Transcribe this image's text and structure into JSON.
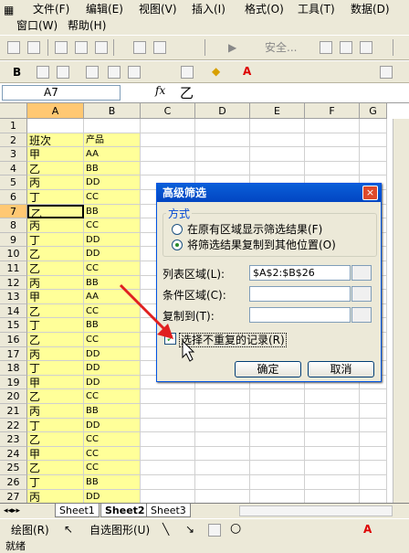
{
  "menubar": {
    "row1": [
      "文件(F)",
      "编辑(E)",
      "视图(V)",
      "插入(I)",
      "格式(O)",
      "工具(T)",
      "数据(D)"
    ],
    "row2": [
      "窗口(W)",
      "帮助(H)"
    ]
  },
  "toolbar": {
    "security_label": "安全..."
  },
  "formula_bar": {
    "name_box": "A7",
    "fx": "fx",
    "value": "乙"
  },
  "columns": [
    "A",
    "B",
    "C",
    "D",
    "E",
    "F",
    "G"
  ],
  "rows": [
    "1",
    "2",
    "3",
    "4",
    "5",
    "6",
    "7",
    "8",
    "9",
    "10",
    "11",
    "12",
    "13",
    "14",
    "15",
    "16",
    "17",
    "18",
    "19",
    "20",
    "21",
    "22",
    "23",
    "24",
    "25",
    "26",
    "27"
  ],
  "col_a": [
    "",
    "班次",
    "甲",
    "乙",
    "丙",
    "丁",
    "乙",
    "丙",
    "丁",
    "乙",
    "乙",
    "丙",
    "甲",
    "乙",
    "丁",
    "乙",
    "丙",
    "丁",
    "甲",
    "乙",
    "丙",
    "丁",
    "乙",
    "甲",
    "乙",
    "丁",
    "丙"
  ],
  "col_b": [
    "",
    "产品",
    "AA",
    "BB",
    "DD",
    "CC",
    "BB",
    "CC",
    "DD",
    "DD",
    "CC",
    "BB",
    "AA",
    "CC",
    "BB",
    "CC",
    "DD",
    "DD",
    "DD",
    "CC",
    "BB",
    "DD",
    "CC",
    "CC",
    "CC",
    "BB",
    "DD"
  ],
  "sheets": [
    "Sheet1",
    "Sheet2",
    "Sheet3"
  ],
  "drawbar": {
    "draw_label": "绘图(R)",
    "autoshape_label": "自选图形(U)"
  },
  "status": "就绪",
  "dialog": {
    "title": "高级筛选",
    "close": "×",
    "method_label": "方式",
    "option1": "在原有区域显示筛选结果(F)",
    "option2": "将筛选结果复制到其他位置(O)",
    "list_range_label": "列表区域(L):",
    "list_range_value": "$A$2:$B$26",
    "criteria_label": "条件区域(C):",
    "copy_to_label": "复制到(T):",
    "unique_label": "选择不重复的记录(R)",
    "ok": "确定",
    "cancel": "取消"
  },
  "colors": {
    "highlight": "#ffff99",
    "title_bar": "#0a5fd8",
    "arrow": "#e02020"
  }
}
